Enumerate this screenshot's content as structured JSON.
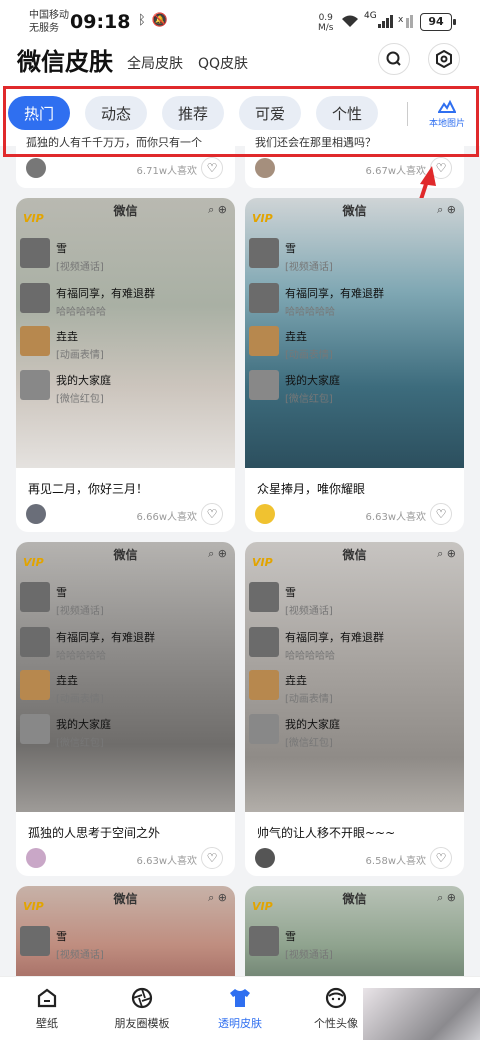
{
  "status": {
    "carrier1": "中国移动",
    "carrier2": "无服务",
    "time": "09:18",
    "net_speed_value": "0.9",
    "net_speed_unit": "M/s",
    "signal": "4G",
    "battery": "94"
  },
  "header": {
    "title": "微信皮肤",
    "tabs": [
      "全局皮肤",
      "QQ皮肤"
    ],
    "search_icon": "search-icon",
    "settings_icon": "settings-icon"
  },
  "categories": {
    "items": [
      "热门",
      "动态",
      "推荐",
      "可爱",
      "个性"
    ],
    "active_index": 0,
    "local_pic_label": "本地图片",
    "accent": "#2f6ff0"
  },
  "partial_cards": [
    {
      "title": "孤独的人有千千万万，而你只有一个",
      "likes": "6.71w人喜欢"
    },
    {
      "title": "我们还会在那里相遇吗？",
      "likes": "6.67w人喜欢"
    }
  ],
  "preview": {
    "app_name": "微信",
    "vip": "VIP",
    "chats": [
      {
        "name": "雪",
        "msg": "[视频通话]"
      },
      {
        "name": "有福同享，有难退群",
        "msg": "哈哈哈哈哈"
      },
      {
        "name": "垚垚",
        "msg": "[动画表情]"
      },
      {
        "name": "我的大家庭",
        "msg": "[微信红包]"
      }
    ]
  },
  "cards": [
    {
      "title": "再见二月，你好三月！",
      "likes": "6.66w人喜欢"
    },
    {
      "title": "众星捧月，唯你耀眼",
      "likes": "6.63w人喜欢"
    },
    {
      "title": "孤独的人思考于空间之外",
      "likes": "6.63w人喜欢"
    },
    {
      "title": "帅气的让人移不开眼~~~",
      "likes": "6.58w人喜欢"
    }
  ],
  "bottom_nav": {
    "items": [
      "壁纸",
      "朋友圈模板",
      "透明皮肤",
      "个性头像"
    ],
    "active_index": 2
  }
}
